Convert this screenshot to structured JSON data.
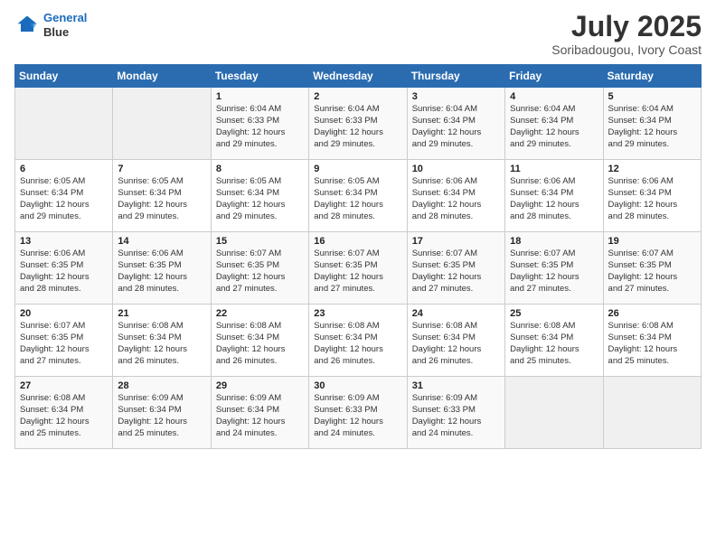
{
  "header": {
    "logo_line1": "General",
    "logo_line2": "Blue",
    "month_year": "July 2025",
    "location": "Soribadougou, Ivory Coast"
  },
  "weekdays": [
    "Sunday",
    "Monday",
    "Tuesday",
    "Wednesday",
    "Thursday",
    "Friday",
    "Saturday"
  ],
  "weeks": [
    [
      {
        "day": "",
        "info": ""
      },
      {
        "day": "",
        "info": ""
      },
      {
        "day": "1",
        "info": "Sunrise: 6:04 AM\nSunset: 6:33 PM\nDaylight: 12 hours\nand 29 minutes."
      },
      {
        "day": "2",
        "info": "Sunrise: 6:04 AM\nSunset: 6:33 PM\nDaylight: 12 hours\nand 29 minutes."
      },
      {
        "day": "3",
        "info": "Sunrise: 6:04 AM\nSunset: 6:34 PM\nDaylight: 12 hours\nand 29 minutes."
      },
      {
        "day": "4",
        "info": "Sunrise: 6:04 AM\nSunset: 6:34 PM\nDaylight: 12 hours\nand 29 minutes."
      },
      {
        "day": "5",
        "info": "Sunrise: 6:04 AM\nSunset: 6:34 PM\nDaylight: 12 hours\nand 29 minutes."
      }
    ],
    [
      {
        "day": "6",
        "info": "Sunrise: 6:05 AM\nSunset: 6:34 PM\nDaylight: 12 hours\nand 29 minutes."
      },
      {
        "day": "7",
        "info": "Sunrise: 6:05 AM\nSunset: 6:34 PM\nDaylight: 12 hours\nand 29 minutes."
      },
      {
        "day": "8",
        "info": "Sunrise: 6:05 AM\nSunset: 6:34 PM\nDaylight: 12 hours\nand 29 minutes."
      },
      {
        "day": "9",
        "info": "Sunrise: 6:05 AM\nSunset: 6:34 PM\nDaylight: 12 hours\nand 28 minutes."
      },
      {
        "day": "10",
        "info": "Sunrise: 6:06 AM\nSunset: 6:34 PM\nDaylight: 12 hours\nand 28 minutes."
      },
      {
        "day": "11",
        "info": "Sunrise: 6:06 AM\nSunset: 6:34 PM\nDaylight: 12 hours\nand 28 minutes."
      },
      {
        "day": "12",
        "info": "Sunrise: 6:06 AM\nSunset: 6:34 PM\nDaylight: 12 hours\nand 28 minutes."
      }
    ],
    [
      {
        "day": "13",
        "info": "Sunrise: 6:06 AM\nSunset: 6:35 PM\nDaylight: 12 hours\nand 28 minutes."
      },
      {
        "day": "14",
        "info": "Sunrise: 6:06 AM\nSunset: 6:35 PM\nDaylight: 12 hours\nand 28 minutes."
      },
      {
        "day": "15",
        "info": "Sunrise: 6:07 AM\nSunset: 6:35 PM\nDaylight: 12 hours\nand 27 minutes."
      },
      {
        "day": "16",
        "info": "Sunrise: 6:07 AM\nSunset: 6:35 PM\nDaylight: 12 hours\nand 27 minutes."
      },
      {
        "day": "17",
        "info": "Sunrise: 6:07 AM\nSunset: 6:35 PM\nDaylight: 12 hours\nand 27 minutes."
      },
      {
        "day": "18",
        "info": "Sunrise: 6:07 AM\nSunset: 6:35 PM\nDaylight: 12 hours\nand 27 minutes."
      },
      {
        "day": "19",
        "info": "Sunrise: 6:07 AM\nSunset: 6:35 PM\nDaylight: 12 hours\nand 27 minutes."
      }
    ],
    [
      {
        "day": "20",
        "info": "Sunrise: 6:07 AM\nSunset: 6:35 PM\nDaylight: 12 hours\nand 27 minutes."
      },
      {
        "day": "21",
        "info": "Sunrise: 6:08 AM\nSunset: 6:34 PM\nDaylight: 12 hours\nand 26 minutes."
      },
      {
        "day": "22",
        "info": "Sunrise: 6:08 AM\nSunset: 6:34 PM\nDaylight: 12 hours\nand 26 minutes."
      },
      {
        "day": "23",
        "info": "Sunrise: 6:08 AM\nSunset: 6:34 PM\nDaylight: 12 hours\nand 26 minutes."
      },
      {
        "day": "24",
        "info": "Sunrise: 6:08 AM\nSunset: 6:34 PM\nDaylight: 12 hours\nand 26 minutes."
      },
      {
        "day": "25",
        "info": "Sunrise: 6:08 AM\nSunset: 6:34 PM\nDaylight: 12 hours\nand 25 minutes."
      },
      {
        "day": "26",
        "info": "Sunrise: 6:08 AM\nSunset: 6:34 PM\nDaylight: 12 hours\nand 25 minutes."
      }
    ],
    [
      {
        "day": "27",
        "info": "Sunrise: 6:08 AM\nSunset: 6:34 PM\nDaylight: 12 hours\nand 25 minutes."
      },
      {
        "day": "28",
        "info": "Sunrise: 6:09 AM\nSunset: 6:34 PM\nDaylight: 12 hours\nand 25 minutes."
      },
      {
        "day": "29",
        "info": "Sunrise: 6:09 AM\nSunset: 6:34 PM\nDaylight: 12 hours\nand 24 minutes."
      },
      {
        "day": "30",
        "info": "Sunrise: 6:09 AM\nSunset: 6:33 PM\nDaylight: 12 hours\nand 24 minutes."
      },
      {
        "day": "31",
        "info": "Sunrise: 6:09 AM\nSunset: 6:33 PM\nDaylight: 12 hours\nand 24 minutes."
      },
      {
        "day": "",
        "info": ""
      },
      {
        "day": "",
        "info": ""
      }
    ]
  ]
}
